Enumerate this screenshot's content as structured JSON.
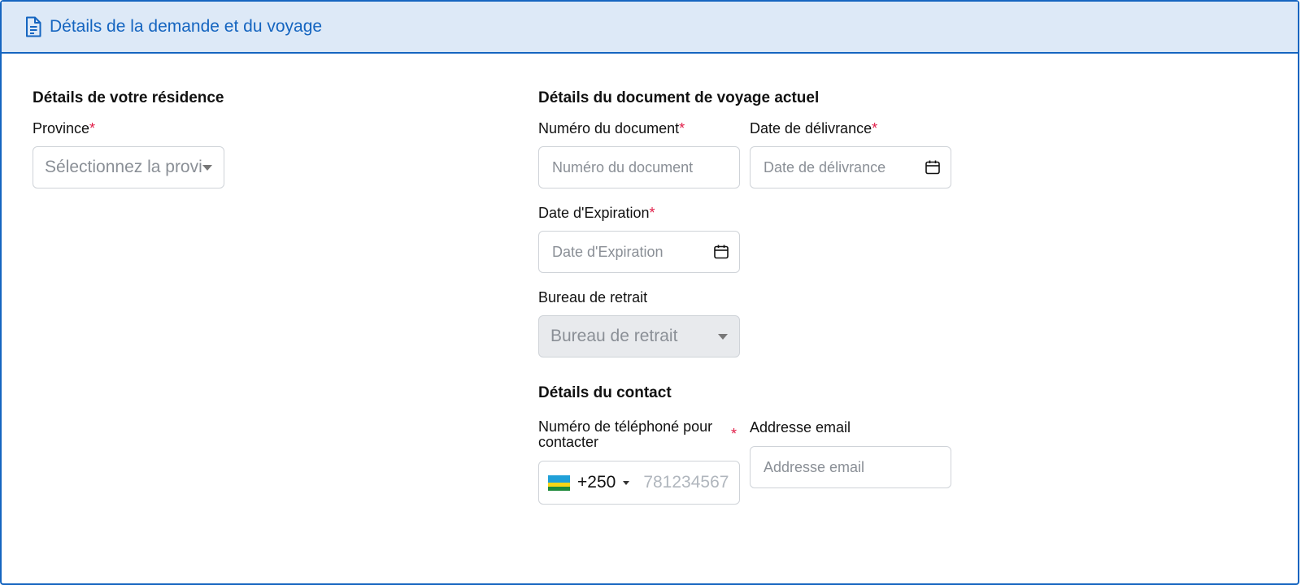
{
  "header": {
    "title": "Détails de la demande et du voyage",
    "icon": "document-icon"
  },
  "residence": {
    "section_title": "Détails de votre résidence",
    "province_label": "Province",
    "province_placeholder": "Sélectionnez la provi"
  },
  "travel_document": {
    "section_title": "Détails du document de voyage actuel",
    "number_label": "Numéro du document",
    "number_placeholder": "Numéro du document",
    "issue_label": "Date de délivrance",
    "issue_placeholder": "Date de délivrance",
    "expiry_label": "Date d'Expiration",
    "expiry_placeholder": "Date d'Expiration",
    "office_label": "Bureau de retrait",
    "office_placeholder": "Bureau de retrait"
  },
  "contact": {
    "section_title": "Détails du contact",
    "phone_label_line1": "Numéro de téléphoné pour",
    "phone_label_line2": "contacter",
    "phone_code": "+250",
    "phone_placeholder": "781234567",
    "email_label": "Addresse email",
    "email_placeholder": "Addresse email"
  },
  "required_marker": "*",
  "colors": {
    "accent": "#1565c0",
    "header_bg": "#dde9f7",
    "required": "#e11d48"
  }
}
